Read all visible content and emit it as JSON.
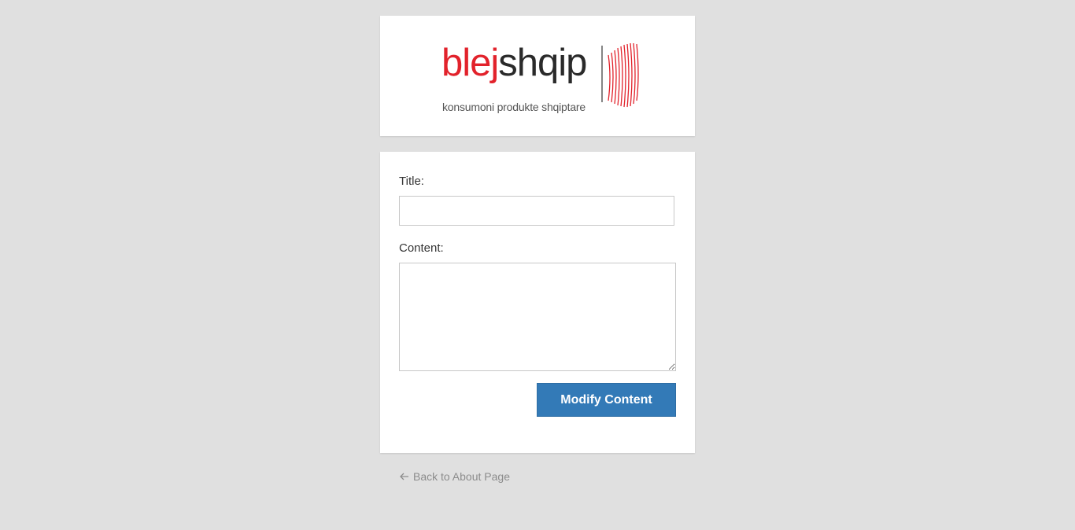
{
  "logo": {
    "word_red": "blej",
    "word_dark": "shqip",
    "tagline": "konsumoni produkte shqiptare",
    "brand_red": "#e2222b"
  },
  "form": {
    "title_label": "Title:",
    "title_value": "",
    "content_label": "Content:",
    "content_value": "",
    "submit_label": "Modify Content",
    "button_color": "#337ab7"
  },
  "nav": {
    "back_label": "Back to About Page",
    "back_icon": "arrow-left-icon"
  }
}
